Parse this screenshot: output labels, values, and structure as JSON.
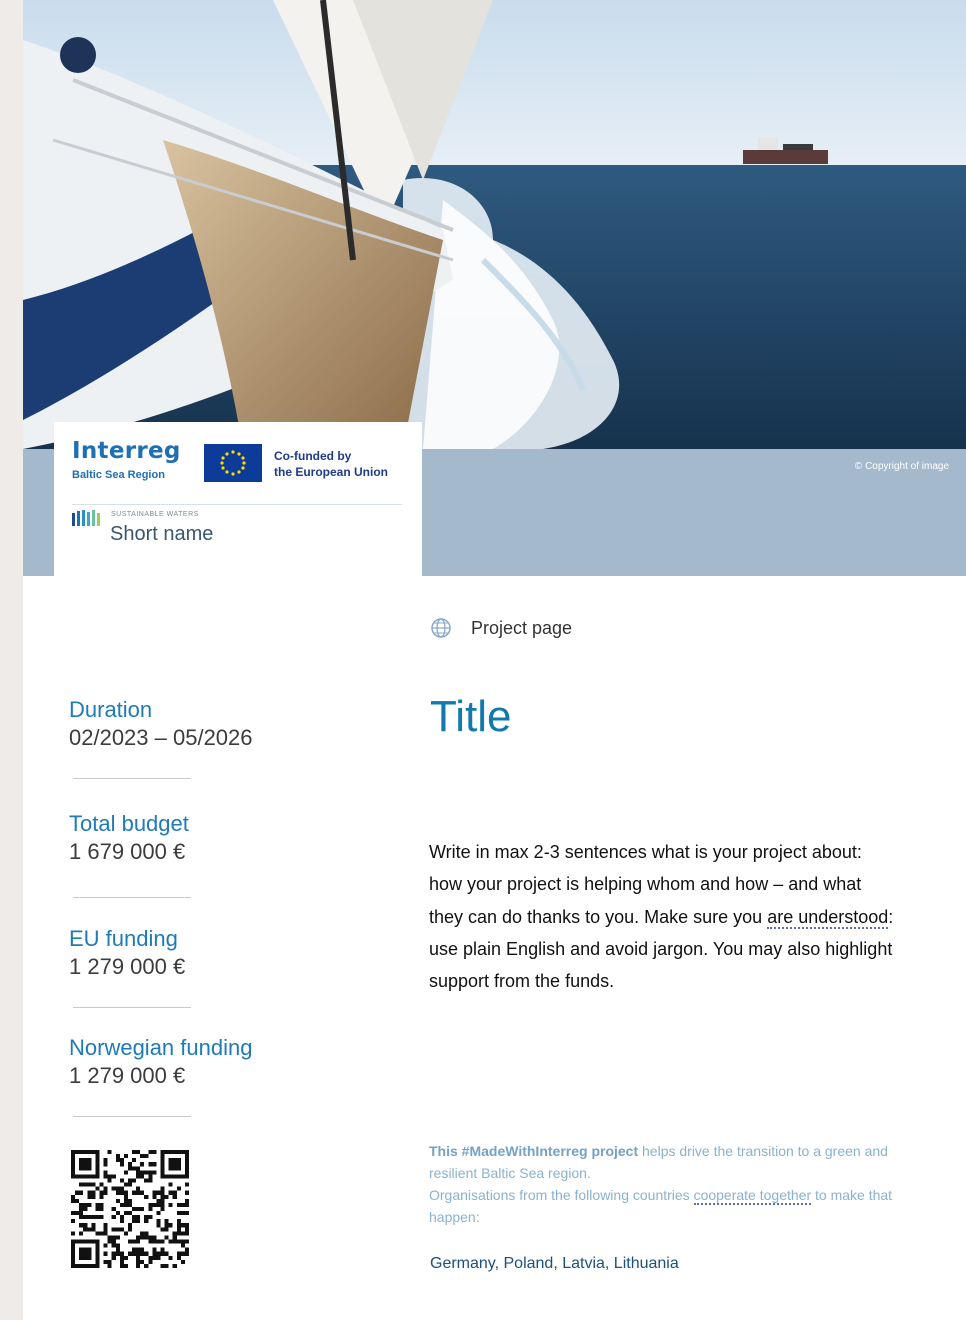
{
  "hero": {
    "copyright": "© Copyright of image"
  },
  "logos": {
    "interreg": "Interreg",
    "baltic_sea_region": "Baltic Sea Region",
    "cofunded_line1": "Co-funded by",
    "cofunded_line2": "the European Union",
    "sustainable_waters": "SUSTAINABLE WATERS",
    "short_name": "Short name"
  },
  "project_link": {
    "icon": "globe-icon",
    "label": "Project page"
  },
  "title": "Title",
  "facts": [
    {
      "label": "Duration",
      "value": "02/2023 – 05/2026"
    },
    {
      "label": "Total budget",
      "value": "1 679 000 €"
    },
    {
      "label": "EU funding",
      "value": "1 279 000 €"
    },
    {
      "label": "Norwegian funding",
      "value": "1 279 000 €"
    }
  ],
  "summary": {
    "part1": "Write in max 2-3 sentences what is your project about: how your project is helping whom and how – and what they can do thanks to you. Make sure you ",
    "underlined": "are understood",
    "part2": ": use plain English and avoid jargon. You may also highlight support from the funds."
  },
  "funds_text": {
    "bold": "This #MadeWithInterreg project",
    "rest1": " helps drive the transition to a green and resilient Baltic Sea region.",
    "line2_start": "Organisations from the following countries ",
    "underlined": "cooperate together",
    "line2_end": " to make that happen:"
  },
  "countries": "Germany, Poland, Latvia, Lithuania",
  "colors": {
    "accent": "#1278ad",
    "band": "#a5b9cd",
    "interreg_blue": "#1f6fb4"
  }
}
